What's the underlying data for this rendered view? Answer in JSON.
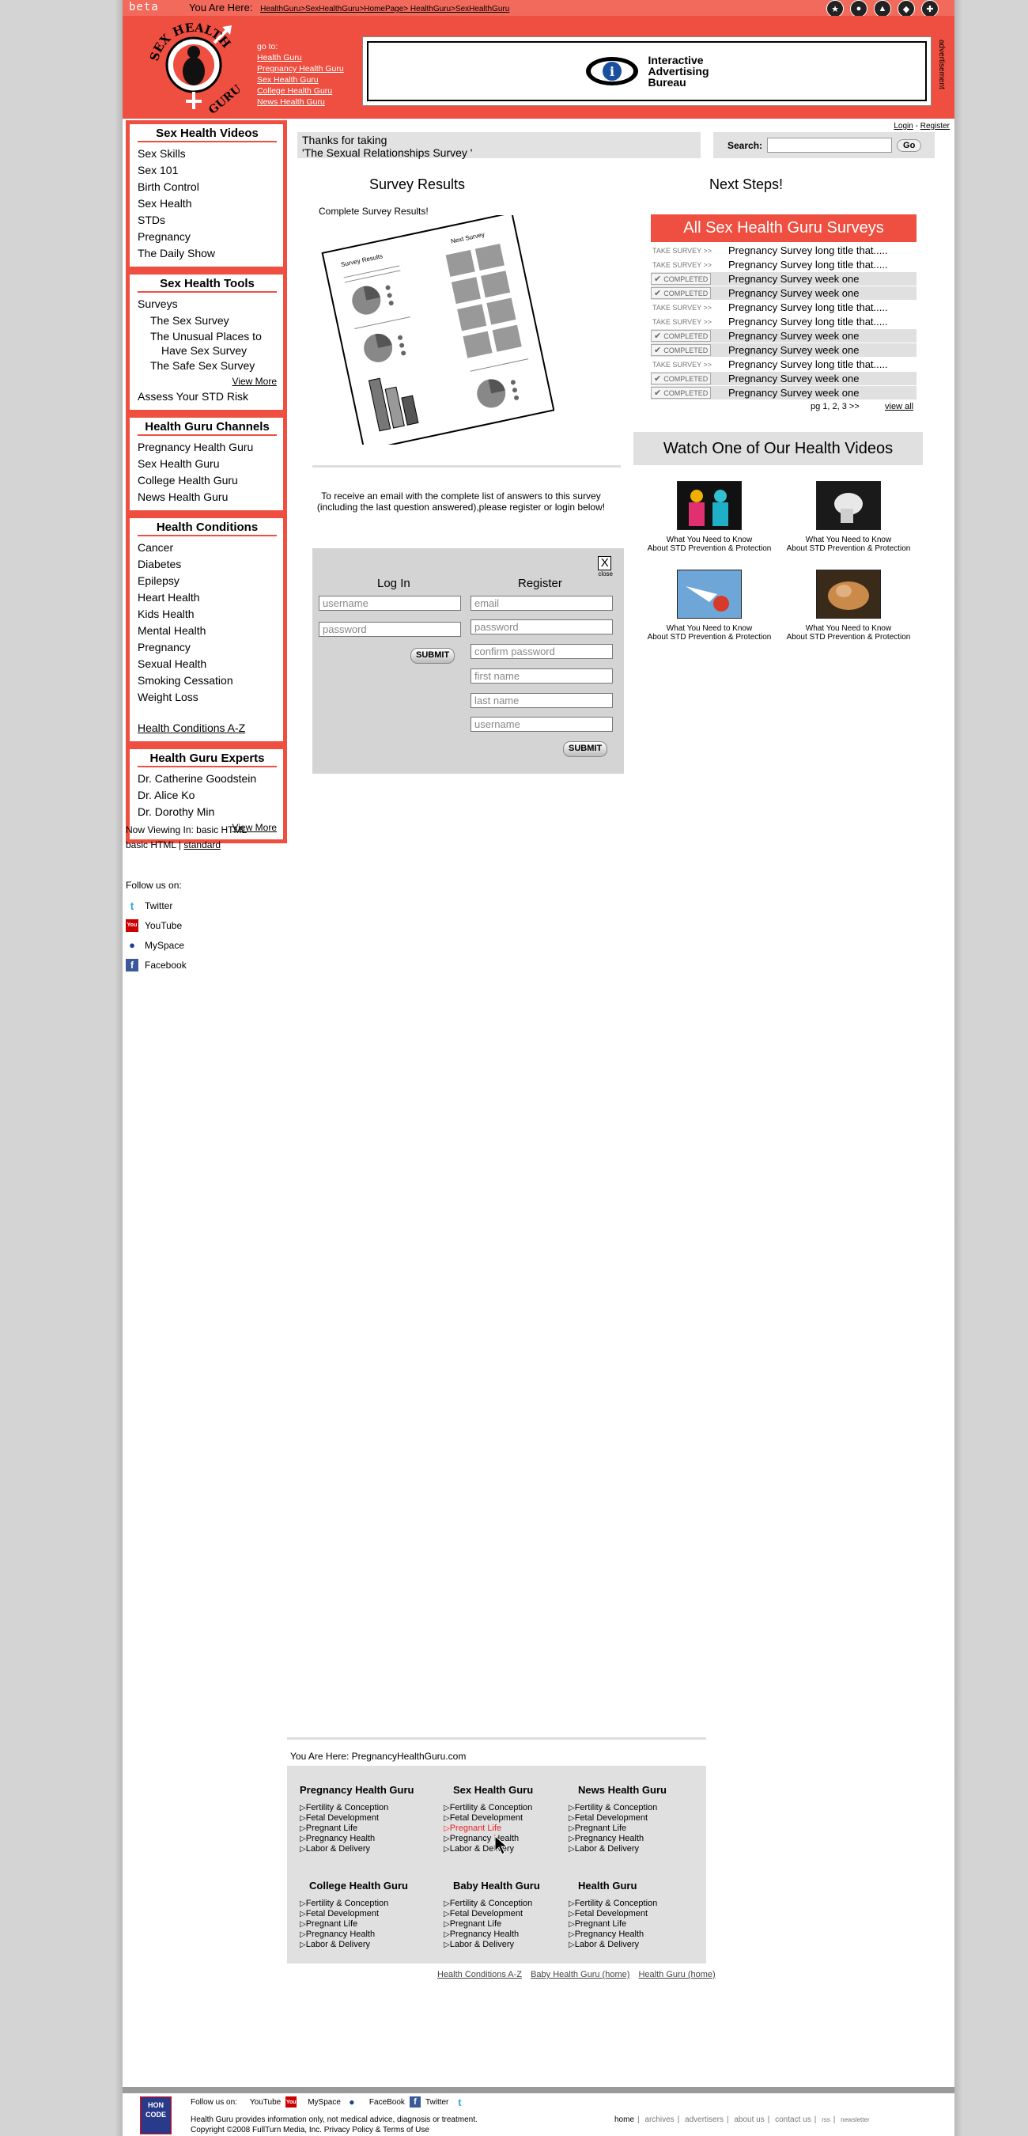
{
  "topbar": {
    "beta": "beta",
    "here_label": "You Are Here:",
    "crumbs": "HealthGuru>SexHealthGuru>HomePage> HealthGuru>SexHealthGuru"
  },
  "header": {
    "logo_text": "SEX HEALTH GURU",
    "goto_label": "go to:",
    "goto_links": [
      "Health Guru",
      "Pregnancy Health Guru",
      "Sex Health Guru",
      "College Health Guru",
      "News Health Guru"
    ],
    "ad_text": [
      "Interactive",
      "Advertising",
      "Bureau"
    ],
    "ad_label": "advertisement"
  },
  "sidebar": {
    "videos": {
      "title": "Sex Health Videos",
      "items": [
        "Sex Skills",
        "Sex 101",
        "Birth Control",
        "Sex Health",
        "STDs",
        "Pregnancy",
        "The Daily Show"
      ]
    },
    "tools": {
      "title": "Sex Health Tools",
      "items": [
        "Surveys",
        "The Sex Survey",
        "The Unusual Places to",
        "Have Sex Survey",
        "The Safe Sex Survey"
      ],
      "more": "View More",
      "extra": "Assess Your STD Risk"
    },
    "channels": {
      "title": "Health Guru Channels",
      "items": [
        "Pregnancy Health Guru",
        "Sex Health Guru",
        "College Health Guru",
        "News Health Guru"
      ]
    },
    "conditions": {
      "title": "Health Conditions",
      "items": [
        "Cancer",
        "Diabetes",
        "Epilepsy",
        "Heart Health",
        "Kids Health",
        "Mental Health",
        "Pregnancy",
        "Sexual Health",
        "Smoking Cessation",
        "Weight Loss"
      ],
      "az": "Health Conditions A-Z"
    },
    "experts": {
      "title": "Health Guru Experts",
      "items": [
        "Dr. Catherine Goodstein",
        "Dr. Alice Ko",
        "Dr. Dorothy Min"
      ],
      "more": "View More"
    },
    "viewing": {
      "label": "Now Viewing In:",
      "mode": "basic HTML",
      "alt1": "basic HTML",
      "sep": "|",
      "alt2": "standard"
    },
    "follow": {
      "label": "Follow us on:",
      "items": [
        "Twitter",
        "YouTube",
        "MySpace",
        "Facebook"
      ]
    }
  },
  "account": {
    "login": "Login",
    "sep": "-",
    "register": "Register"
  },
  "thanks": {
    "line1": "Thanks for taking",
    "line2": "'The Sexual Relationships Survey '"
  },
  "search": {
    "label": "Search:",
    "value": "",
    "go": "Go"
  },
  "results": {
    "title": "Survey Results",
    "complete": "Complete Survey Results!",
    "illus_left": "Survey Results",
    "illus_right": "Next Survey",
    "email_msg": "To receive an email with the complete list of answers to this survey (including the last question answered),please register or login below!"
  },
  "auth": {
    "close_x": "X",
    "close_label": "close",
    "login_title": "Log In",
    "register_title": "Register",
    "login_fields": [
      "username",
      "password"
    ],
    "register_fields": [
      "email",
      "password",
      "confirm password",
      "first name",
      "last name",
      "username"
    ],
    "submit": "SUBMIT"
  },
  "next": {
    "title": "Next Steps!",
    "surveys_title": "All Sex Health Guru Surveys",
    "take_label": "TAKE SURVEY >>",
    "completed_label": "COMPLETED",
    "rows": [
      {
        "status": "take",
        "text": "Pregnancy Survey long title that....."
      },
      {
        "status": "take",
        "text": "Pregnancy Survey long title that....."
      },
      {
        "status": "completed",
        "text": "Pregnancy Survey week one"
      },
      {
        "status": "completed",
        "text": "Pregnancy Survey week one"
      },
      {
        "status": "take",
        "text": "Pregnancy Survey long title that....."
      },
      {
        "status": "take",
        "text": "Pregnancy Survey long title that....."
      },
      {
        "status": "completed",
        "text": "Pregnancy Survey week one"
      },
      {
        "status": "completed",
        "text": "Pregnancy Survey week one"
      },
      {
        "status": "take",
        "text": "Pregnancy Survey long title that....."
      },
      {
        "status": "completed",
        "text": "Pregnancy Survey week one"
      },
      {
        "status": "completed",
        "text": "Pregnancy Survey week one"
      }
    ],
    "pager": "pg 1, 2, 3 >>",
    "view_all": "view all",
    "watch_title": "Watch One of Our Health Videos",
    "videos": [
      {
        "line1": "What You Need to Know",
        "line2": "About STD Prevention & Protection"
      },
      {
        "line1": "What You Need to Know",
        "line2": "About STD Prevention & Protection"
      },
      {
        "line1": "What You Need to Know",
        "line2": "About STD Prevention & Protection"
      },
      {
        "line1": "What You Need to Know",
        "line2": "About STD Prevention & Protection"
      }
    ]
  },
  "footer_links": {
    "here": "You Are Here: PregnancyHealthGuru.com",
    "columns": [
      {
        "title": "Pregnancy Health Guru",
        "items": [
          "Fertility & Conception",
          "Fetal Development",
          "Pregnant Life",
          "Pregnancy Health",
          "Labor & Delivery"
        ]
      },
      {
        "title": "Sex Health Guru",
        "items": [
          "Fertility & Conception",
          "Fetal Development",
          "Pregnant Life",
          "Pregnancy Health",
          "Labor & Delivery"
        ]
      },
      {
        "title": "News Health Guru",
        "items": [
          "Fertility & Conception",
          "Fetal Development",
          "Pregnant Life",
          "Pregnancy Health",
          "Labor & Delivery"
        ]
      },
      {
        "title": "College Health Guru",
        "items": [
          "Fertility & Conception",
          "Fetal Development",
          "Pregnant Life",
          "Pregnancy Health",
          "Labor & Delivery"
        ]
      },
      {
        "title": "Baby Health Guru",
        "items": [
          "Fertility & Conception",
          "Fetal Development",
          "Pregnant Life",
          "Pregnancy Health",
          "Labor & Delivery"
        ]
      },
      {
        "title": "Health Guru",
        "items": [
          "Fertility & Conception",
          "Fetal Development",
          "Pregnant Life",
          "Pregnancy Health",
          "Labor & Delivery"
        ]
      }
    ],
    "bottom": [
      "Health Conditions A-Z",
      "Baby Health Guru (home)",
      "Health Guru  (home)"
    ]
  },
  "footer": {
    "hon": "HON CODE",
    "follow_label": "Follow us on:",
    "follow": [
      "YouTube",
      "MySpace",
      "FaceBook",
      "Twitter"
    ],
    "disclaimer": "Health Guru provides information only, not medical advice, diagnosis or treatment.",
    "copyright": "Copyright ©2008 FullTurn Media, Inc. Privacy Policy & Terms of Use",
    "nav": [
      "home",
      "archives",
      "advertisers",
      "about us",
      "contact us",
      "rss",
      "newsletter"
    ]
  },
  "colors": {
    "brand_red": "#ef4f40",
    "topbar": "#f26a5c",
    "panel_gray": "#e0e0e0"
  }
}
